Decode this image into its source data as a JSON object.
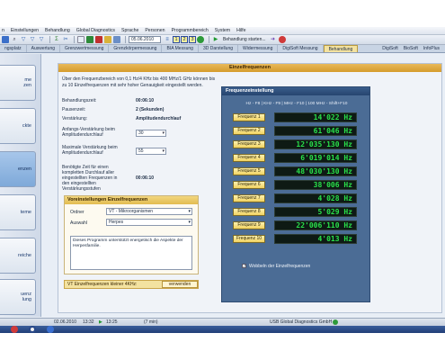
{
  "menubar": {
    "items": [
      "n",
      "Einstellungen",
      "Behandlung",
      "Global Diagnostics",
      "Sprache",
      "Personen",
      "Programmbereich",
      "System",
      "Hilfe"
    ]
  },
  "toolbar": {
    "date": "05.06.2010",
    "numbers": [
      "1",
      "2",
      "3"
    ],
    "start_label": "Behandlung starten..."
  },
  "tabs": {
    "items": [
      "ngsplatz",
      "Auswertung",
      "Grenzwertmessung",
      "Grenzkörpermessung",
      "BIA Messung",
      "3D Darstellung",
      "Widermessung",
      "DigiSoft Messung",
      "Behandlung"
    ],
    "active_index": 8,
    "right": [
      "DigiSoft",
      "BioSoft",
      "InfoPlus"
    ]
  },
  "sidebar": {
    "items": [
      "me\nzen",
      "ckte",
      "enzen",
      "teme",
      "reiche",
      "uenz\nlung"
    ],
    "active_index": 2
  },
  "main": {
    "header": "Einzelfrequenzen",
    "intro": "Über den Frequenzbereich von 0,1 Hz/4 KHz bis 400 MHz/1 GHz können bis zu 10 Einzelfrequenzen mit sehr hoher Genauigkeit eingestellt werden.",
    "rows": [
      {
        "label": "Behandlungszeit:",
        "value": "00:06:10"
      },
      {
        "label": "Pausenzeit:",
        "value": "2   (Sekunden)"
      },
      {
        "label": "Verstärkung:",
        "value": "Amplitudendurchlauf"
      }
    ],
    "selects": [
      {
        "label": "Anfangs-Verstärkung beim Amplitudendurchlauf",
        "value": "30"
      },
      {
        "label": "Maximale Verstärkung beim Amplitudendurchlauf",
        "value": "55"
      }
    ],
    "duration": {
      "label": "Benötigte Zeit für einen kompletten Durchlauf aller eingestellten Frequenzen in den eingestellten Verstärkungsstufen",
      "value": "00:06:10"
    },
    "preset": {
      "title": "Voreinstellungen Einzelfrequenzen",
      "folder_label": "Ordner",
      "folder_value": "VT - Mikroorganismen",
      "select_label": "Auswahl",
      "select_value": "Herpes",
      "description": "Dieses Programm unterstützt energetisch die Aspekte der Herpesfamilie."
    },
    "footer_text": "VT Einzelfrequenzen kleiner 4KHz:",
    "use_button": "verwenden"
  },
  "freq": {
    "title": "Frequenzeinstellung",
    "subtitle": "Hz - F8 | KHz - F9 | MHz - F10 | 100 MHz - Shift+F10",
    "buttons": [
      "Frequenz 1",
      "Frequenz 2",
      "Frequenz 3",
      "Frequenz 4",
      "Frequenz 5",
      "Frequenz 6",
      "Frequenz 7",
      "Frequenz 8",
      "Frequenz 9",
      "Frequenz 10"
    ],
    "values": [
      "14'022 Hz",
      "61'046 Hz",
      "12'035'130 Hz",
      "6'019'014 Hz",
      "48'030'130 Hz",
      "38'006 Hz",
      "4'028 Hz",
      "5'029 Hz",
      "22'006'110 Hz",
      "4'013 Hz"
    ],
    "wobble_label": "Wobbeln der Einzelfrequenzen",
    "wobble_checked": true
  },
  "status": {
    "date": "02.06.2010",
    "time": "13:32",
    "timer": "13:25",
    "duration": "(7 min)",
    "device": "USB Global Diagnostics GmbH"
  }
}
